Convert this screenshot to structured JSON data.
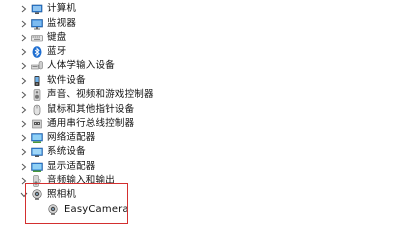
{
  "device_manager": {
    "categories": [
      {
        "label": "计算机",
        "icon": "computer-icon",
        "expanded": false
      },
      {
        "label": "监视器",
        "icon": "monitor-icon",
        "expanded": false
      },
      {
        "label": "键盘",
        "icon": "keyboard-icon",
        "expanded": false
      },
      {
        "label": "蓝牙",
        "icon": "bluetooth-icon",
        "expanded": false
      },
      {
        "label": "人体学输入设备",
        "icon": "hid-icon",
        "expanded": false
      },
      {
        "label": "软件设备",
        "icon": "software-device-icon",
        "expanded": false
      },
      {
        "label": "声音、视频和游戏控制器",
        "icon": "speaker-icon",
        "expanded": false
      },
      {
        "label": "鼠标和其他指针设备",
        "icon": "mouse-icon",
        "expanded": false
      },
      {
        "label": "通用串行总线控制器",
        "icon": "usb-icon",
        "expanded": false
      },
      {
        "label": "网络适配器",
        "icon": "network-adapter-icon",
        "expanded": false
      },
      {
        "label": "系统设备",
        "icon": "system-device-icon",
        "expanded": false
      },
      {
        "label": "显示适配器",
        "icon": "display-adapter-icon",
        "expanded": false
      },
      {
        "label": "音频输入和输出",
        "icon": "audio-io-icon",
        "expanded": false
      },
      {
        "label": "照相机",
        "icon": "camera-icon",
        "expanded": true,
        "children": [
          {
            "label": "EasyCamera",
            "icon": "webcam-icon"
          }
        ]
      }
    ]
  },
  "colors": {
    "highlight_border": "#d32f2f",
    "icon_blue": "#2e7fd6",
    "chevron": "#555555"
  }
}
